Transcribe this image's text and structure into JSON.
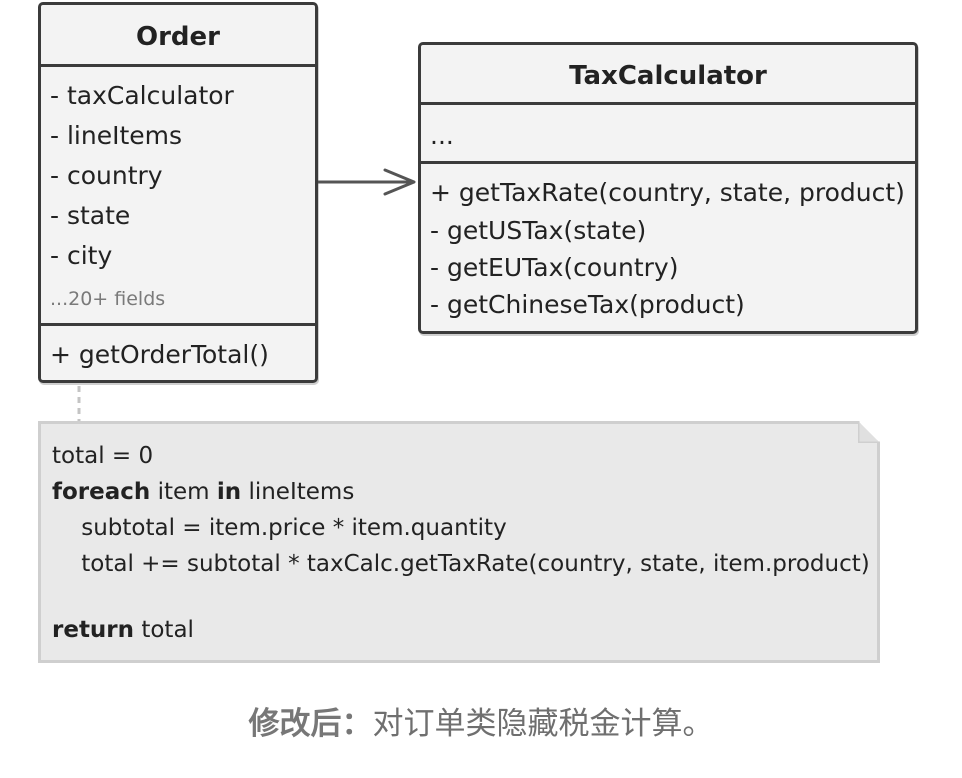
{
  "order": {
    "title": "Order",
    "fields": [
      "- taxCalculator",
      "- lineItems",
      "- country",
      "- state",
      "- city"
    ],
    "more_fields": "...20+ fields",
    "methods": [
      "+ getOrderTotal()"
    ]
  },
  "tax_calculator": {
    "title": "TaxCalculator",
    "fields": [
      "..."
    ],
    "methods": [
      "+ getTaxRate(country, state, product)",
      "- getUSTax(state)",
      "- getEUTax(country)",
      "- getChineseTax(product)"
    ]
  },
  "note": {
    "lines": [
      [
        {
          "t": "total = 0",
          "b": false
        }
      ],
      [
        {
          "t": "foreach",
          "b": true
        },
        {
          "t": " item ",
          "b": false
        },
        {
          "t": "in",
          "b": true
        },
        {
          "t": " lineItems",
          "b": false
        }
      ],
      [
        {
          "t": "    subtotal = item.price * item.quantity",
          "b": false
        }
      ],
      [
        {
          "t": "    total += subtotal * taxCalc.getTaxRate(country, state, item.product)",
          "b": false
        }
      ],
      [
        {
          "t": "",
          "b": false
        }
      ],
      [
        {
          "t": "return",
          "b": true
        },
        {
          "t": " total",
          "b": false
        }
      ]
    ]
  },
  "caption": {
    "label": "修改后：",
    "text": "对订单类隐藏税金计算。"
  }
}
